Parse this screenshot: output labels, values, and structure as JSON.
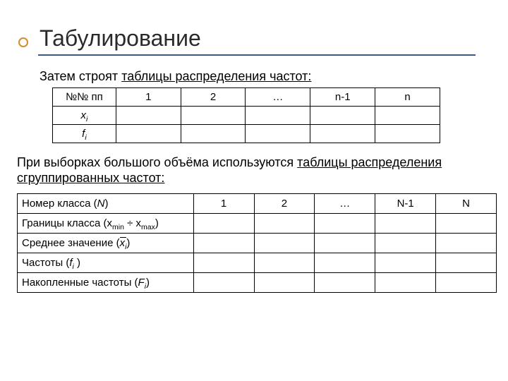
{
  "title": "Табулирование",
  "intro_plain": "Затем строят ",
  "intro_underline": "таблицы распределения частот:",
  "table1": {
    "row1_head": "№№ пп",
    "row2_head": "x",
    "row2_sub": "i",
    "row3_head": "f",
    "row3_sub": "i",
    "cols": [
      "1",
      "2",
      "…",
      "n-1",
      "n"
    ]
  },
  "para2_plain": "При выборках большого объёма используются ",
  "para2_underline": "таблицы распределения сгруппированных частот:",
  "table2": {
    "row1_label_a": "Номер класса (",
    "row1_label_b": "N",
    "row1_label_c": ")",
    "row2_label_a": "Границы класса (x",
    "row2_label_min": "min",
    "row2_label_mid": " ÷ x",
    "row2_label_max": "max",
    "row2_label_c": ")",
    "row3_label_a": "Среднее значение (",
    "row3_label_x": "x",
    "row3_label_sub": "i",
    "row3_label_c": ")",
    "row4_label_a": "Частоты  (",
    "row4_label_f": "f",
    "row4_label_sub": "i",
    "row4_label_c": " )",
    "row5_label_a": "Накопленные частоты (",
    "row5_label_F": "F",
    "row5_label_sub": "i",
    "row5_label_c": ")",
    "cols": [
      "1",
      "2",
      "…",
      "N-1",
      "N"
    ]
  }
}
